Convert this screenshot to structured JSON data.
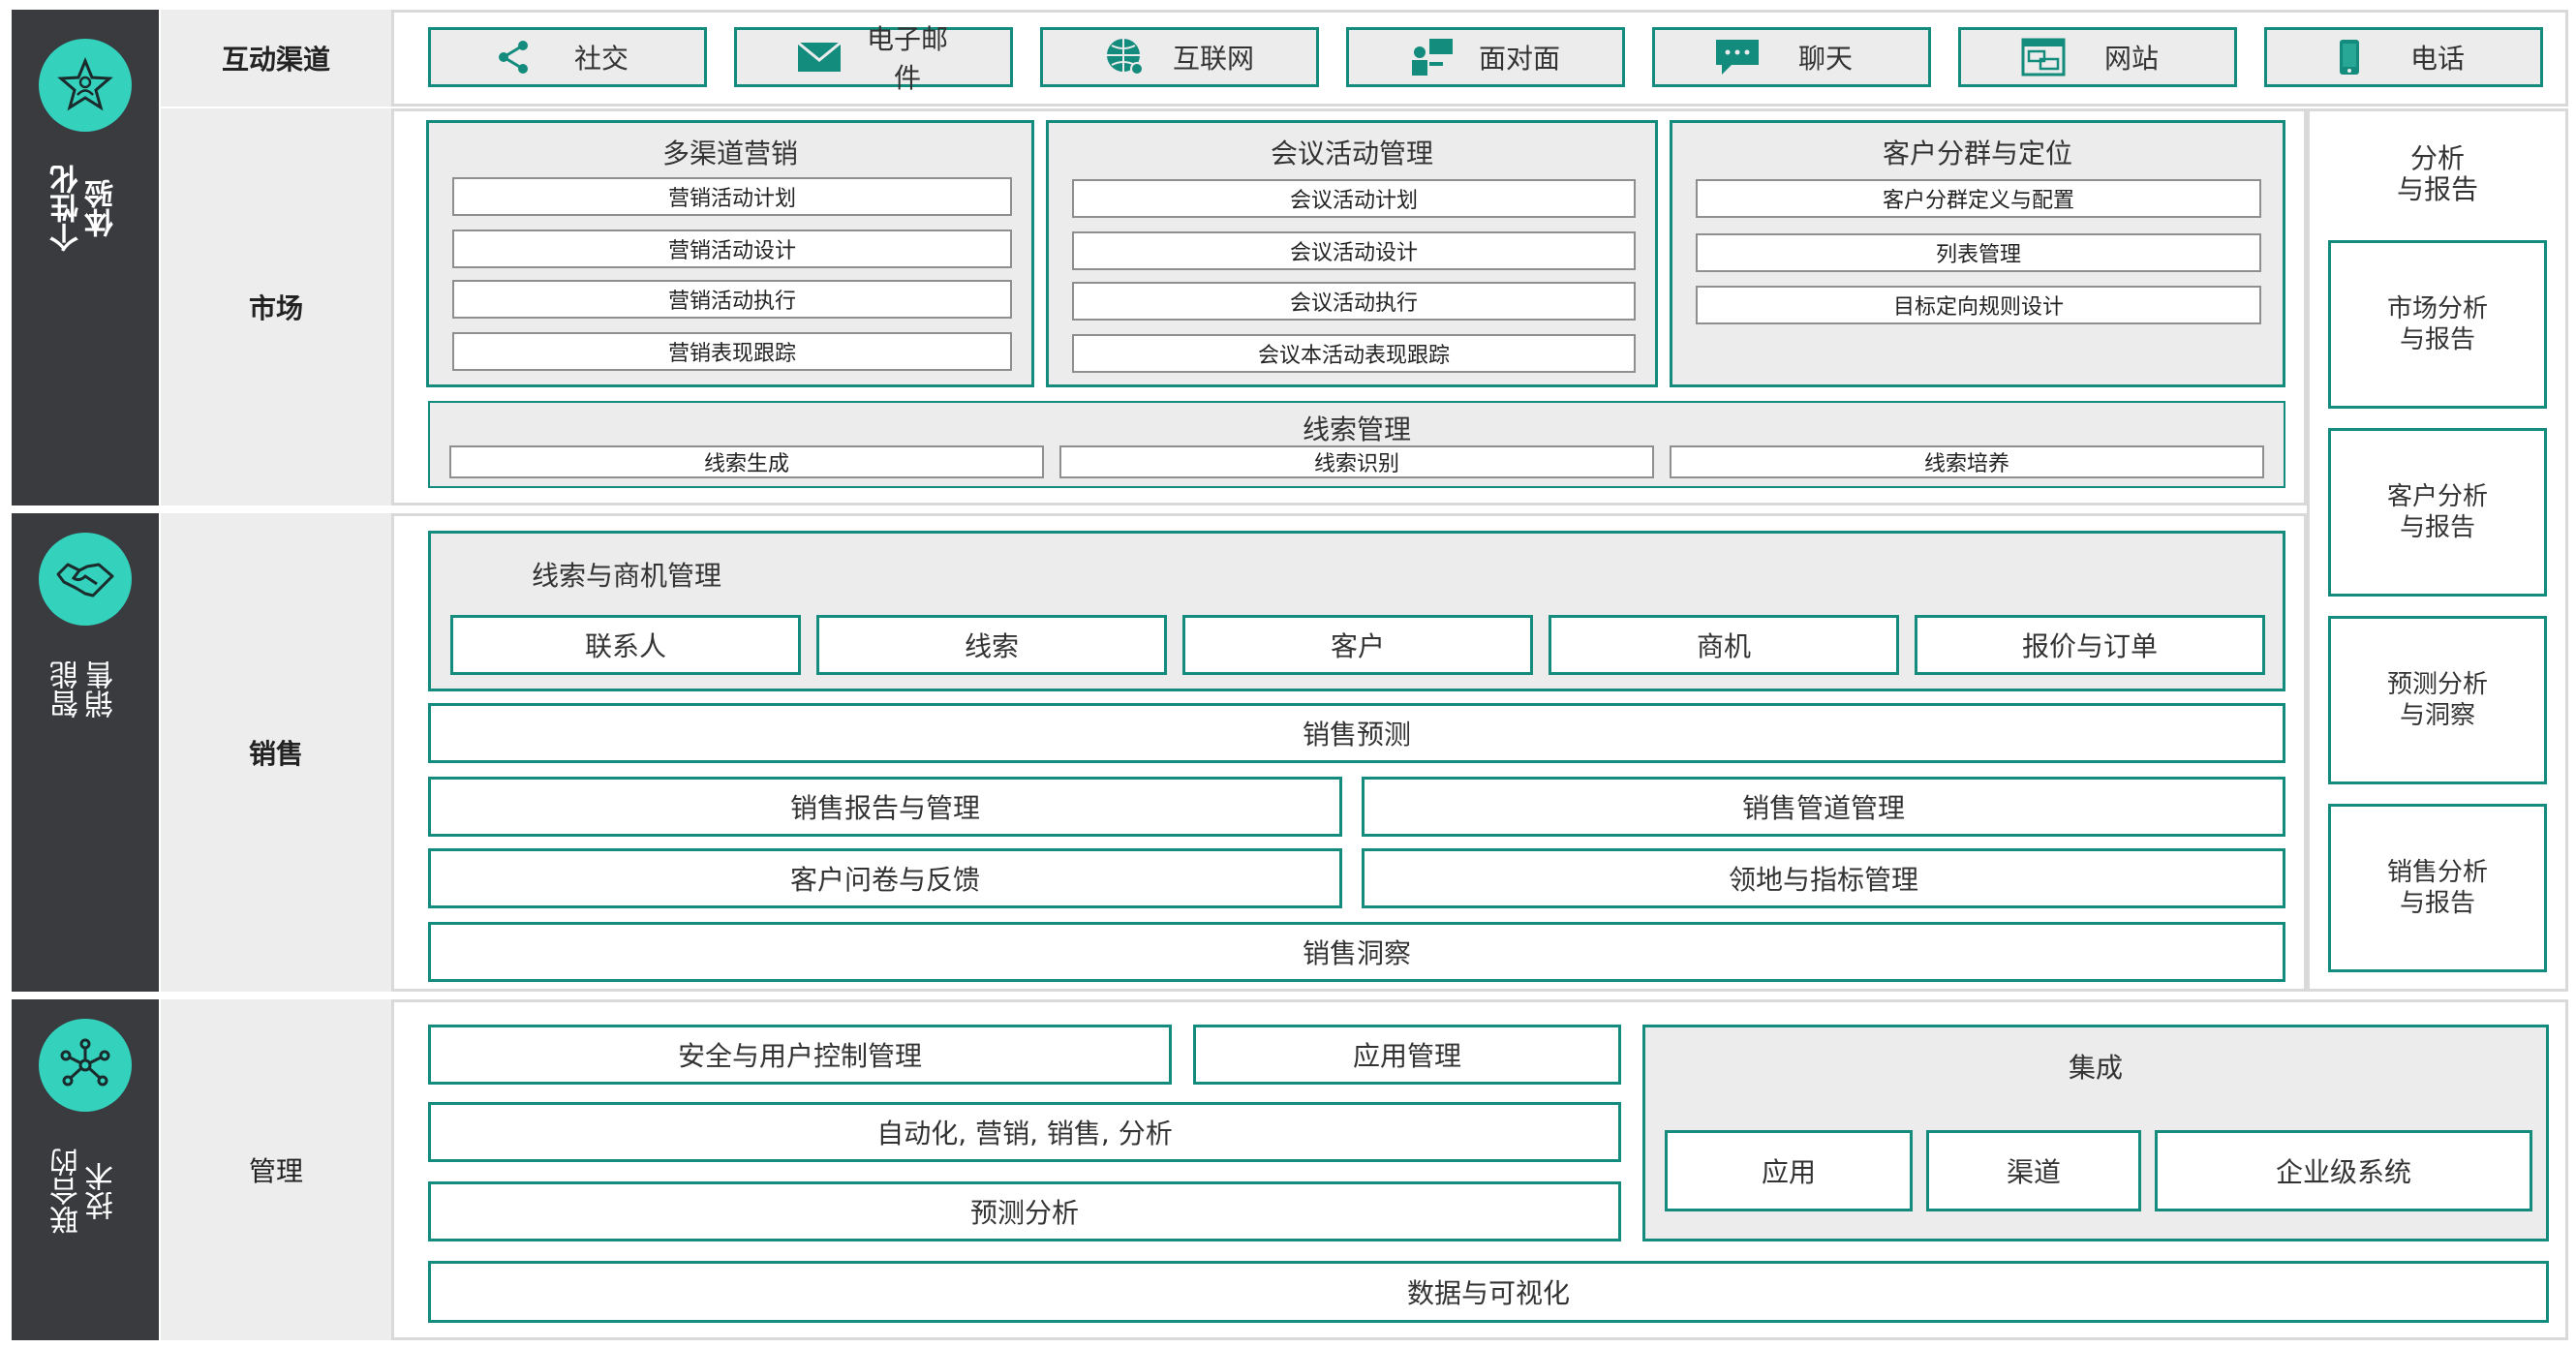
{
  "left_bands": [
    {
      "label": "个性化\n体验",
      "icon": "star-badge-icon"
    },
    {
      "label": "智能\n销售",
      "icon": "handshake-icon"
    },
    {
      "label": "联合的\n技术",
      "icon": "network-icon"
    }
  ],
  "rows": {
    "channels": "互动渠道",
    "market": "市场",
    "sales": "销售",
    "management": "管理"
  },
  "channels": [
    {
      "label": "社交",
      "icon": "share-icon"
    },
    {
      "label": "电子邮件",
      "icon": "envelope-icon"
    },
    {
      "label": "互联网",
      "icon": "globe-icon"
    },
    {
      "label": "面对面",
      "icon": "meeting-icon"
    },
    {
      "label": "聊天",
      "icon": "chat-icon"
    },
    {
      "label": "网站",
      "icon": "website-icon"
    },
    {
      "label": "电话",
      "icon": "phone-icon"
    }
  ],
  "market": {
    "multichannel": {
      "title": "多渠道营销",
      "items": [
        "营销活动计划",
        "营销活动设计",
        "营销活动执行",
        "营销表现跟踪"
      ]
    },
    "events": {
      "title": "会议活动管理",
      "items": [
        "会议活动计划",
        "会议活动设计",
        "会议活动执行",
        "会议本活动表现跟踪"
      ]
    },
    "segmentation": {
      "title": "客户分群与定位",
      "items": [
        "客户分群定义与配置",
        "列表管理",
        "目标定向规则设计"
      ]
    },
    "leads": {
      "title": "线索管理",
      "items": [
        "线索生成",
        "线索识别",
        "线索培养"
      ]
    }
  },
  "sales": {
    "lead_opp": {
      "title": "线索与商机管理",
      "items": [
        "联系人",
        "线索",
        "客户",
        "商机",
        "报价与订单"
      ]
    },
    "forecast": "销售预测",
    "report_mgmt": "销售报告与管理",
    "pipeline": "销售管道管理",
    "survey": "客户问卷与反馈",
    "territory": "领地与指标管理",
    "insight": "销售洞察"
  },
  "analytics": {
    "title": "分析\n与报告",
    "items": [
      "市场分析\n与报告",
      "客户分析\n与报告",
      "预测分析\n与洞察",
      "销售分析\n与报告"
    ]
  },
  "management": {
    "security": "安全与用户控制管理",
    "app_mgmt": "应用管理",
    "automation": "自动化, 营销, 销售, 分析",
    "predictive": "预测分析",
    "integration": {
      "title": "集成",
      "items": [
        "应用",
        "渠道",
        "企业级系统"
      ]
    },
    "data_viz": "数据与可视化"
  },
  "colors": {
    "teal": "#138b7d",
    "accent": "#34d1bd",
    "band": "#3a3b3f",
    "panel_bg": "#ececec"
  }
}
